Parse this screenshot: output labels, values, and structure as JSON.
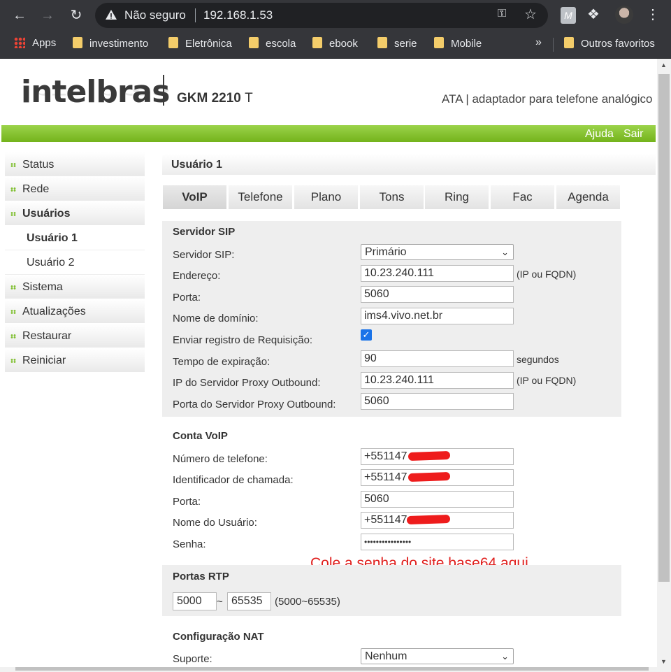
{
  "browser": {
    "security_label": "Não seguro",
    "url": "192.168.1.53",
    "bookmarks": [
      "Apps",
      "investimento",
      "Eletrônica",
      "escola",
      "ebook",
      "serie",
      "Mobile"
    ],
    "more": "»",
    "other_bookmarks": "Outros favoritos"
  },
  "header": {
    "brand": "intelbras",
    "model": "GKM 2210",
    "model_suffix": "T",
    "tagline": "ATA | adaptador para telefone analógico",
    "help": "Ajuda",
    "logout": "Sair",
    "brand_color": "#7fbf30"
  },
  "sidebar": {
    "items": [
      "Status",
      "Rede",
      "Usuários"
    ],
    "sub_items": [
      "Usuário 1",
      "Usuário 2"
    ],
    "more_items": [
      "Sistema",
      "Atualizações",
      "Restaurar",
      "Reiniciar"
    ]
  },
  "main": {
    "title": "Usuário 1",
    "tabs": [
      "VoIP",
      "Telefone",
      "Plano",
      "Tons",
      "Ring",
      "Fac",
      "Agenda"
    ],
    "sip": {
      "title": "Servidor SIP",
      "server_label": "Servidor SIP:",
      "server_value": "Primário",
      "address_label": "Endereço:",
      "address_value": "10.23.240.111",
      "address_hint": "(IP ou FQDN)",
      "port_label": "Porta:",
      "port_value": "5060",
      "domain_label": "Nome de domínio:",
      "domain_value": "ims4.vivo.net.br",
      "register_label": "Enviar registro de Requisição:",
      "register_checked": true,
      "expire_label": "Tempo de expiração:",
      "expire_value": "90",
      "expire_unit": "segundos",
      "proxy_label": "IP do Servidor Proxy Outbound:",
      "proxy_value": "10.23.240.111",
      "proxy_hint": "(IP ou FQDN)",
      "proxy_port_label": "Porta do Servidor Proxy Outbound:",
      "proxy_port_value": "5060"
    },
    "account": {
      "title": "Conta VoIP",
      "phone_label": "Número de telefone:",
      "phone_value": "+551147",
      "caller_label": "Identificador de chamada:",
      "caller_value": "+551147",
      "port_label": "Porta:",
      "port_value": "5060",
      "user_label": "Nome do Usuário:",
      "user_value": "+551147",
      "password_label": "Senha:",
      "password_value": "••••••••••••••••"
    },
    "annotation": "Cole a senha do site base64 aqui",
    "rtp": {
      "title": "Portas RTP",
      "from": "5000",
      "sep": "~",
      "to": "65535",
      "range_hint": "(5000~65535)"
    },
    "nat": {
      "title": "Configuração NAT",
      "support_label": "Suporte:",
      "support_value": "Nenhum"
    }
  }
}
